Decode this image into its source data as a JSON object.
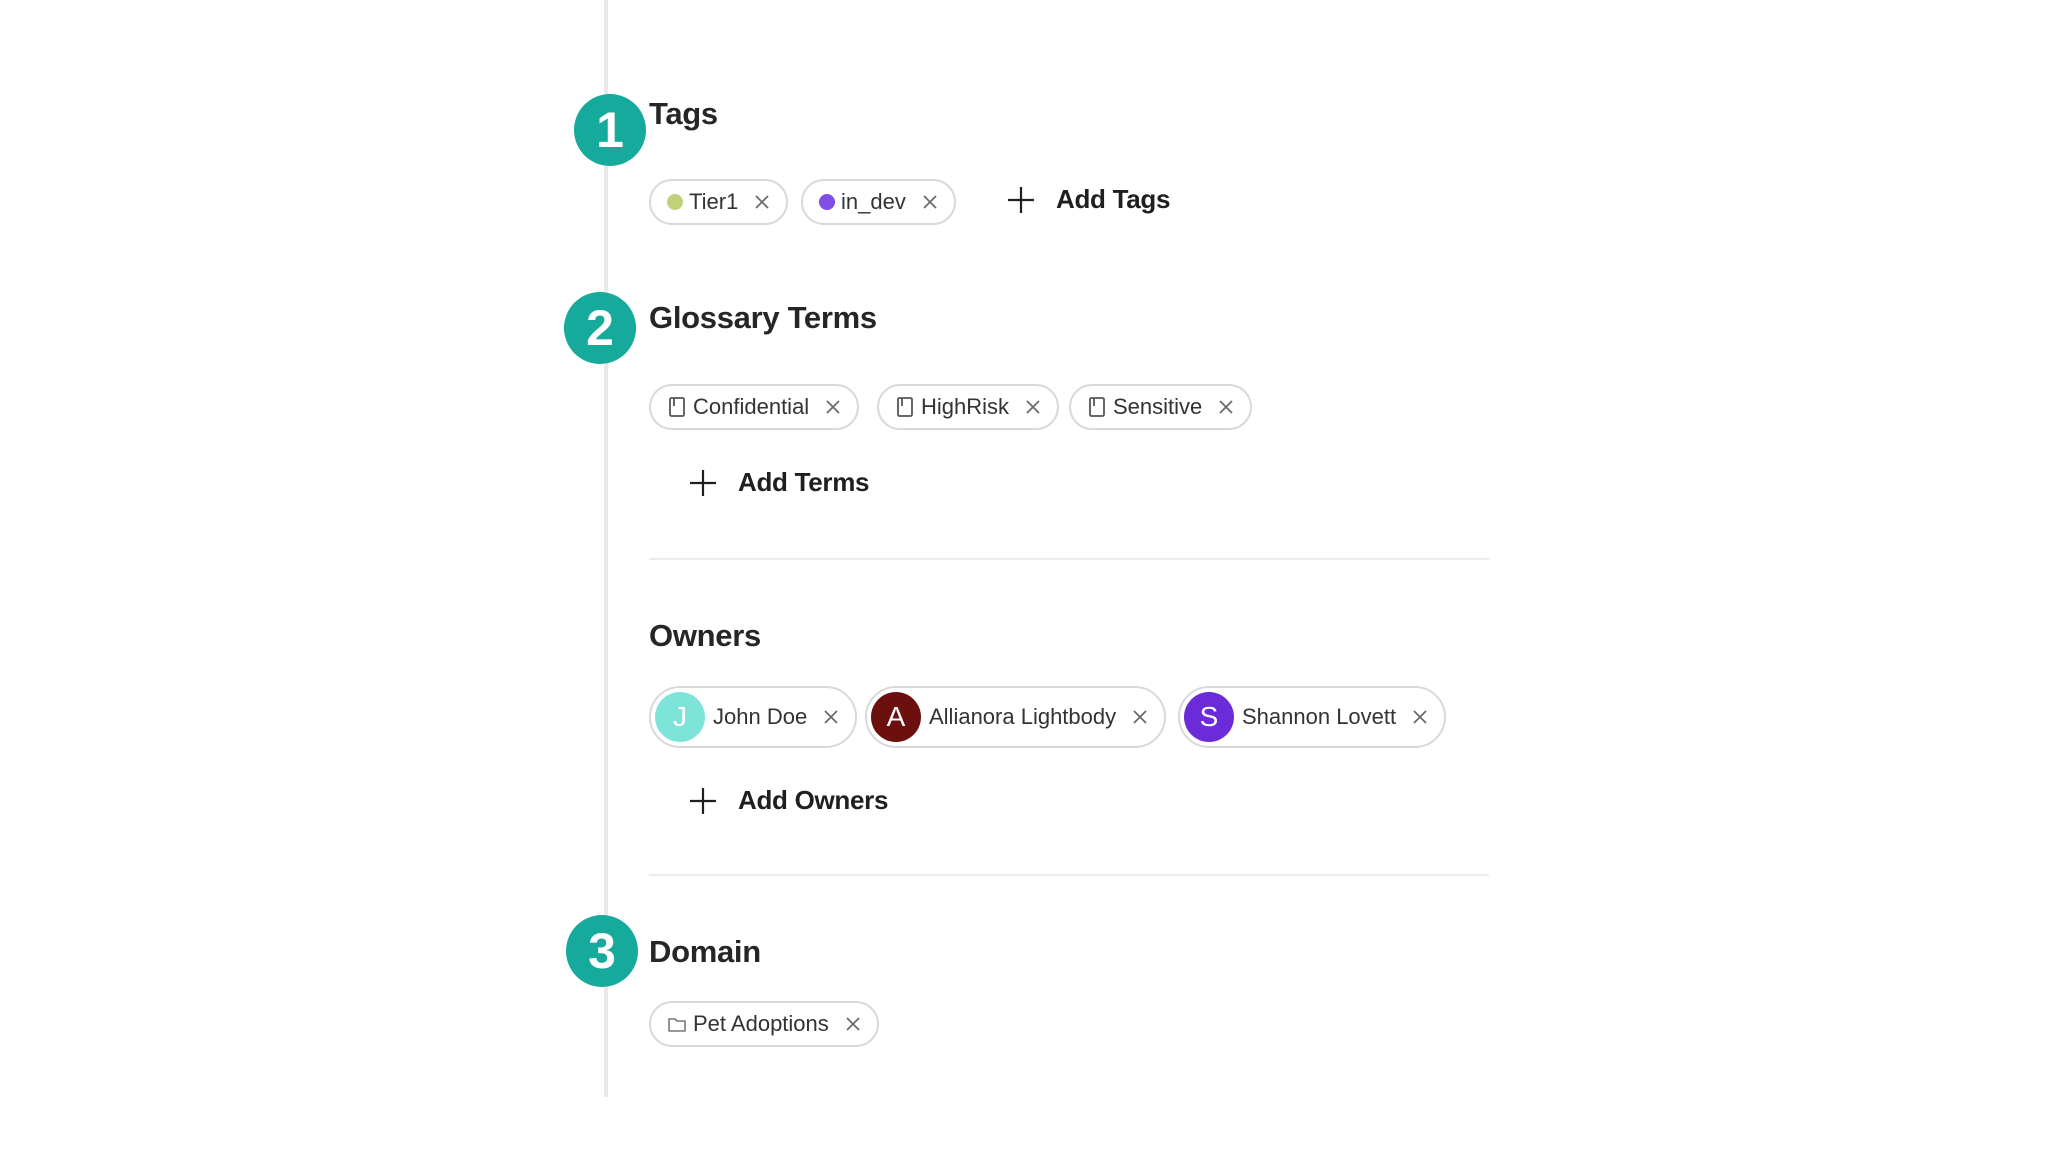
{
  "steps": {
    "tags": "1",
    "glossary": "2",
    "domain": "3"
  },
  "tags": {
    "heading": "Tags",
    "items": [
      {
        "label": "Tier1",
        "color": "#bfd27a"
      },
      {
        "label": "in_dev",
        "color": "#7f4ee6"
      }
    ],
    "add_label": "Add Tags"
  },
  "glossary": {
    "heading": "Glossary Terms",
    "items": [
      {
        "label": "Confidential",
        "icon": "book-icon"
      },
      {
        "label": "HighRisk",
        "icon": "book-icon"
      },
      {
        "label": "Sensitive",
        "icon": "book-icon"
      }
    ],
    "add_label": "Add Terms"
  },
  "owners": {
    "heading": "Owners",
    "items": [
      {
        "name": "John Doe",
        "initial": "J",
        "color": "#7ee3d8"
      },
      {
        "name": "Allianora Lightbody",
        "initial": "A",
        "color": "#6b0f0f"
      },
      {
        "name": "Shannon Lovett",
        "initial": "S",
        "color": "#6c2bd9"
      }
    ],
    "add_label": "Add Owners"
  },
  "domain": {
    "heading": "Domain",
    "items": [
      {
        "label": "Pet Adoptions",
        "icon": "folder-icon"
      }
    ]
  },
  "colors": {
    "accent": "#16aa9c",
    "chip_border": "#d9d9d9",
    "timeline": "#e9e9e9"
  }
}
